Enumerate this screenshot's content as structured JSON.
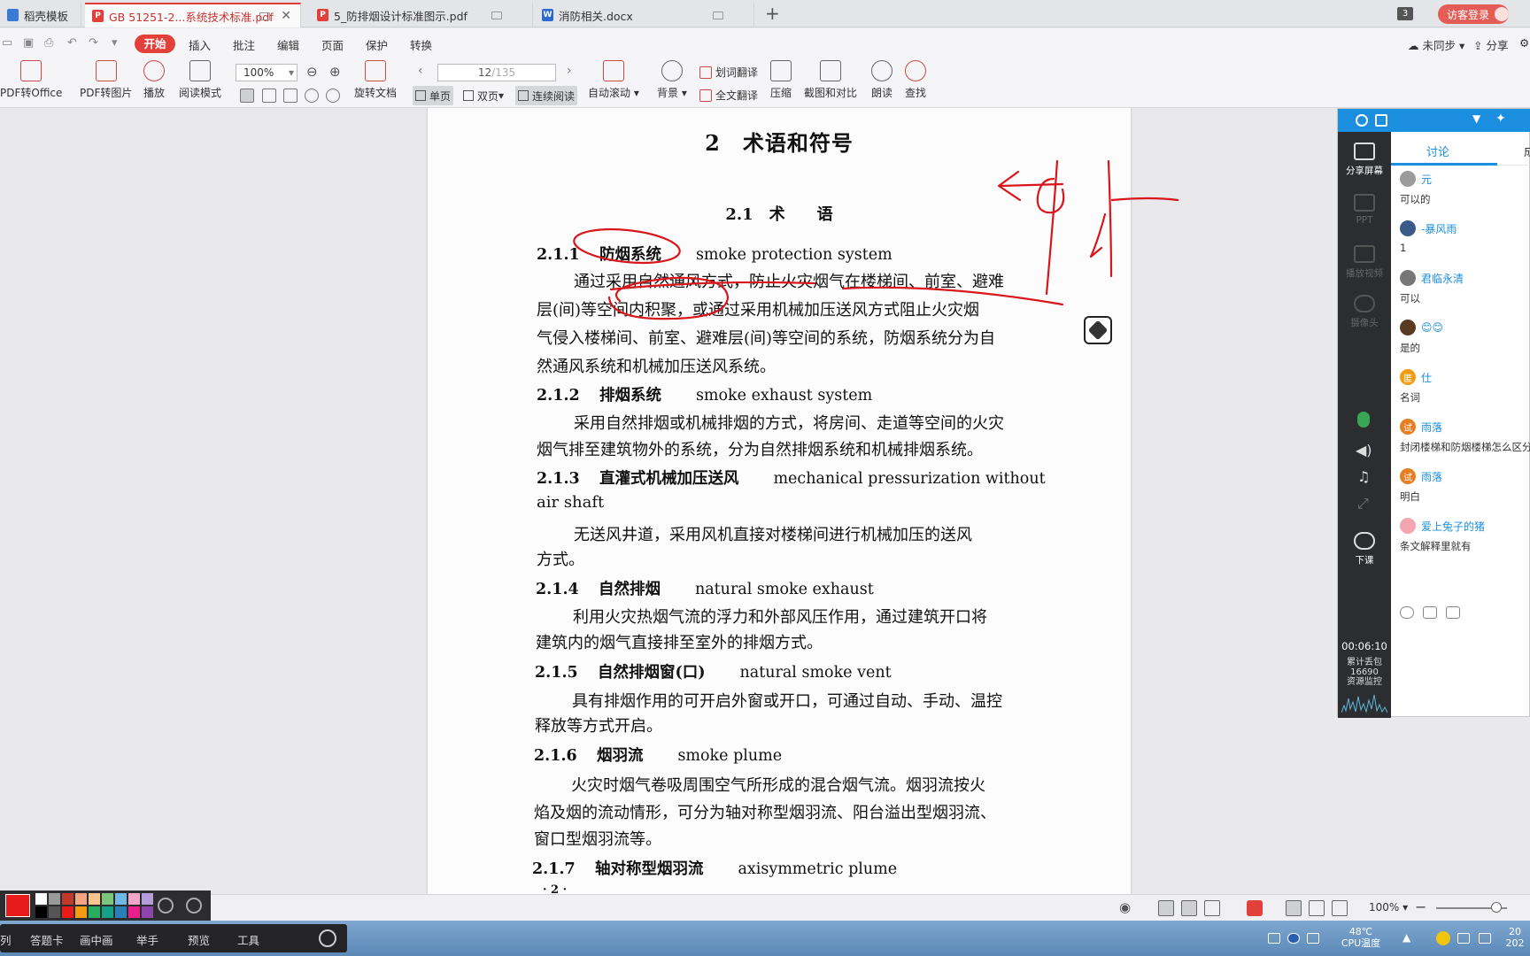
{
  "tabs": [
    {
      "label": "稻壳模板",
      "icon": "daoke-icon"
    },
    {
      "label": "GB 51251-2...系统技术标准.pdf",
      "icon": "pdf-icon"
    },
    {
      "label": "5_防排烟设计标准图示.pdf",
      "icon": "pdf-icon"
    },
    {
      "label": "消防相关.docx",
      "icon": "word-icon"
    }
  ],
  "tab_count": "3",
  "login_label": "访客登录",
  "menu": {
    "start": "开始",
    "items": [
      "插入",
      "批注",
      "编辑",
      "页面",
      "保护",
      "转换"
    ],
    "sync": "未同步",
    "share": "分享"
  },
  "ribbon": {
    "pdf_to_office": "PDF转Office",
    "pdf_to_image": "PDF转图片",
    "play": "播放",
    "read_mode": "阅读模式",
    "zoom": "100%",
    "rotate": "旋转文档",
    "page_current": "12",
    "page_total": "/135",
    "single": "单页",
    "double": "双页",
    "continuous": "连续阅读",
    "auto_scroll": "自动滚动",
    "background": "背景",
    "word_translate": "划词翻译",
    "full_translate": "全文翻译",
    "compress": "压缩",
    "screenshot_compare": "截图和对比",
    "read_aloud": "朗读",
    "find": "查找"
  },
  "document": {
    "chapter": "2　术语和符号",
    "section": "2.1　术　　语",
    "terms": [
      {
        "num": "2.1.1",
        "cn": "防烟系统",
        "en": "smoke protection system",
        "body": [
          "通过采用自然通风方式，防止火灾烟气在楼梯间、前室、避难",
          "层(间)等空间内积聚，或通过采用机械加压送风方式阻止火灾烟",
          "气侵入楼梯间、前室、避难层(间)等空间的系统，防烟系统分为自",
          "然通风系统和机械加压送风系统。"
        ]
      },
      {
        "num": "2.1.2",
        "cn": "排烟系统",
        "en": "smoke exhaust system",
        "body": [
          "采用自然排烟或机械排烟的方式，将房间、走道等空间的火灾",
          "烟气排至建筑物外的系统，分为自然排烟系统和机械排烟系统。"
        ]
      },
      {
        "num": "2.1.3",
        "cn": "直灌式机械加压送风",
        "en": "mechanical pressurization without",
        "en2": "air shaft",
        "body": [
          "无送风井道，采用风机直接对楼梯间进行机械加压的送风",
          "方式。"
        ]
      },
      {
        "num": "2.1.4",
        "cn": "自然排烟",
        "en": "natural smoke exhaust",
        "body": [
          "利用火灾热烟气流的浮力和外部风压作用，通过建筑开口将",
          "建筑内的烟气直接排至室外的排烟方式。"
        ]
      },
      {
        "num": "2.1.5",
        "cn": "自然排烟窗(口)",
        "en": "natural smoke vent",
        "body": [
          "具有排烟作用的可开启外窗或开口，可通过自动、手动、温控",
          "释放等方式开启。"
        ]
      },
      {
        "num": "2.1.6",
        "cn": "烟羽流",
        "en": "smoke plume",
        "body": [
          "火灾时烟气卷吸周围空气所形成的混合烟气流。烟羽流按火",
          "焰及烟的流动情形，可分为轴对称型烟羽流、阳台溢出型烟羽流、",
          "窗口型烟羽流等。"
        ]
      },
      {
        "num": "2.1.7",
        "cn": "轴对称型烟羽流",
        "en": "axisymmetric plume",
        "body": []
      }
    ],
    "page_footer": "· 2 ·"
  },
  "panel": {
    "side": [
      "分享屏幕",
      "PPT",
      "播放视频",
      "摄像头"
    ],
    "end_class": "下课",
    "timer": "00:06:10",
    "stat1": "累计丢包",
    "stat2": "16690",
    "stat3": "资源监控",
    "tab_discuss": "讨论",
    "tab_other": "成",
    "messages": [
      {
        "name": "元",
        "text": "可以的",
        "color": "#9b9b9b"
      },
      {
        "name": "-暴风雨",
        "text": "1",
        "color": "#3a5a8a"
      },
      {
        "name": "君临永清",
        "text": "可以",
        "color": "#777777"
      },
      {
        "name": "😊😊",
        "text": "是的",
        "color": "#5b3a24"
      },
      {
        "name": "仕",
        "text": "名词",
        "color": "#f39c12",
        "badge": "匿"
      },
      {
        "name": "雨落",
        "text": "封闭楼梯和防烟楼梯怎么区分",
        "color": "#e67e22",
        "badge": "试"
      },
      {
        "name": "雨落",
        "text": "明白",
        "color": "#e67e22",
        "badge": "试"
      },
      {
        "name": "爱上兔子的猪",
        "text": "条文解释里就有",
        "color": "#f4a6b0"
      }
    ]
  },
  "statusbar": {
    "zoom": "100%"
  },
  "classbar": {
    "items": [
      "列",
      "答题卡",
      "画中画",
      "举手",
      "预览",
      "工具"
    ]
  },
  "tray": {
    "temp": "48℃",
    "temp_label": "CPU温度",
    "clock1": "20",
    "clock2": "202"
  },
  "palette_colors": [
    "#ffffff",
    "#9a9a9a",
    "#c0392b",
    "#f4a582",
    "#f7c68f",
    "#7bc67b",
    "#6fb8e6",
    "#f0a6c8",
    "#b39ddb",
    "#000000",
    "#555555",
    "#e81b1b",
    "#f39c12",
    "#27ae60",
    "#16a085",
    "#2980b9",
    "#e91e8c",
    "#8e44ad"
  ]
}
